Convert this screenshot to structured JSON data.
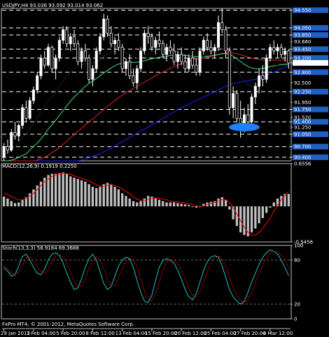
{
  "header": {
    "symbol_line": "USDJPY,H4  93.036 93.092 93.014 93.062",
    "macd_label": "MACD(12,26,9) 0.1919 0.2250",
    "stoch_label": "Stoch(13,3,3) 58.9184 69.3688",
    "footer_label": "FxPro MT4, © 2001-2012, MetaQuotes Software Corp."
  },
  "colors": {
    "background": "#000000",
    "frame": "#c0c0c0",
    "up_candle": "#ffffff",
    "down_candle": "#000000",
    "candle_outline": "#ffffff",
    "level_line": "#ffffff",
    "level_box": "#2060c0",
    "price_box": "#ffffff",
    "ma_fast": "#000000",
    "ma_green": "#40e080",
    "ma_red": "#e02020",
    "ma_blue": "#2020ff",
    "macd_hist": "#c0c0c0",
    "macd_signal": "#ff0000",
    "stoch_main": "#20c0c0",
    "stoch_signal": "#ff0000",
    "ellipse": "#1e80ff"
  },
  "chart_data": [
    {
      "type": "candlestick",
      "title": "USDJPY,H4",
      "ylim": [
        90.3,
        94.6
      ],
      "price_labels": [
        {
          "value": 94.55,
          "label": "94.550"
        },
        {
          "value": 94.05,
          "label": "94.050"
        },
        {
          "value": 93.85,
          "label": "93.850"
        },
        {
          "value": 93.66,
          "label": "93.660"
        },
        {
          "value": 93.45,
          "label": "93.450"
        },
        {
          "value": 93.2,
          "label": "93.200"
        },
        {
          "value": 93.062,
          "label": "93.062",
          "current": true
        },
        {
          "value": 92.8,
          "label": "92.800"
        },
        {
          "value": 92.5,
          "label": "92.500"
        },
        {
          "value": 92.25,
          "label": "92.250"
        },
        {
          "value": 91.95,
          "label": "91.950"
        },
        {
          "value": 91.75,
          "label": "91.750"
        },
        {
          "value": 91.52,
          "label": "91.520"
        },
        {
          "value": 91.4,
          "label": "91.400"
        },
        {
          "value": 91.25,
          "label": "91.250"
        },
        {
          "value": 91.05,
          "label": "91.050"
        },
        {
          "value": 90.7,
          "label": "90.700"
        },
        {
          "value": 90.4,
          "label": "90.400"
        }
      ],
      "levels": [
        94.55,
        94.05,
        93.85,
        93.45,
        93.2,
        92.8,
        92.25,
        91.75,
        91.4,
        91.05,
        90.7,
        90.4
      ],
      "ohlc": [
        [
          90.4,
          90.8,
          90.3,
          90.7
        ],
        [
          90.7,
          90.9,
          90.5,
          90.6
        ],
        [
          90.6,
          91.2,
          90.55,
          91.1
        ],
        [
          91.1,
          91.4,
          90.9,
          91.0
        ],
        [
          91.0,
          91.35,
          90.85,
          91.3
        ],
        [
          91.3,
          91.9,
          91.2,
          91.8
        ],
        [
          91.8,
          92.0,
          91.4,
          91.5
        ],
        [
          91.5,
          92.1,
          91.45,
          92.0
        ],
        [
          92.0,
          92.4,
          91.9,
          92.3
        ],
        [
          92.3,
          92.8,
          92.2,
          92.7
        ],
        [
          92.7,
          93.3,
          92.6,
          93.2
        ],
        [
          93.2,
          93.4,
          92.9,
          93.0
        ],
        [
          93.0,
          93.6,
          92.95,
          93.5
        ],
        [
          93.5,
          93.55,
          92.8,
          92.9
        ],
        [
          92.9,
          93.3,
          92.6,
          93.2
        ],
        [
          93.2,
          93.8,
          93.1,
          93.7
        ],
        [
          93.7,
          94.1,
          93.6,
          94.0
        ],
        [
          94.0,
          94.1,
          93.5,
          93.6
        ],
        [
          93.6,
          93.9,
          93.4,
          93.8
        ],
        [
          93.8,
          94.0,
          93.5,
          93.6
        ],
        [
          93.6,
          93.7,
          93.0,
          93.1
        ],
        [
          93.1,
          93.5,
          92.9,
          93.4
        ],
        [
          93.4,
          93.6,
          93.1,
          93.2
        ],
        [
          93.2,
          93.3,
          92.5,
          92.6
        ],
        [
          92.6,
          93.0,
          92.4,
          92.9
        ],
        [
          92.9,
          93.5,
          92.8,
          93.4
        ],
        [
          93.4,
          93.9,
          93.3,
          93.8
        ],
        [
          93.8,
          94.45,
          93.7,
          94.3
        ],
        [
          94.3,
          94.4,
          93.8,
          93.9
        ],
        [
          93.9,
          94.1,
          93.5,
          93.6
        ],
        [
          93.6,
          93.8,
          93.3,
          93.7
        ],
        [
          93.7,
          93.9,
          93.4,
          93.5
        ],
        [
          93.5,
          93.6,
          92.8,
          92.9
        ],
        [
          92.9,
          93.2,
          92.7,
          93.1
        ],
        [
          93.1,
          93.3,
          92.6,
          92.7
        ],
        [
          92.7,
          92.9,
          92.4,
          92.5
        ],
        [
          92.5,
          93.0,
          92.3,
          92.9
        ],
        [
          92.9,
          93.5,
          92.8,
          93.4
        ],
        [
          93.4,
          94.0,
          93.3,
          93.9
        ],
        [
          93.9,
          94.1,
          93.6,
          93.8
        ],
        [
          93.8,
          93.9,
          93.4,
          93.5
        ],
        [
          93.5,
          93.8,
          93.3,
          93.7
        ],
        [
          93.7,
          93.95,
          93.5,
          93.6
        ],
        [
          93.6,
          93.7,
          93.2,
          93.3
        ],
        [
          93.3,
          93.6,
          93.1,
          93.5
        ],
        [
          93.5,
          93.7,
          93.3,
          93.4
        ],
        [
          93.4,
          93.6,
          93.0,
          93.1
        ],
        [
          93.1,
          93.4,
          92.9,
          93.3
        ],
        [
          93.3,
          93.5,
          93.0,
          93.1
        ],
        [
          93.1,
          93.3,
          92.8,
          92.9
        ],
        [
          92.9,
          93.3,
          92.8,
          93.2
        ],
        [
          93.2,
          93.4,
          92.9,
          93.0
        ],
        [
          93.0,
          93.2,
          92.7,
          92.8
        ],
        [
          92.8,
          93.5,
          92.7,
          93.4
        ],
        [
          93.4,
          93.8,
          93.3,
          93.7
        ],
        [
          93.7,
          93.9,
          93.4,
          93.5
        ],
        [
          93.5,
          93.7,
          93.3,
          93.4
        ],
        [
          93.4,
          93.6,
          93.2,
          93.5
        ],
        [
          93.5,
          94.4,
          93.4,
          94.2
        ],
        [
          94.2,
          94.6,
          93.9,
          94.0
        ],
        [
          94.0,
          94.1,
          93.2,
          93.4
        ],
        [
          93.4,
          93.5,
          91.6,
          91.8
        ],
        [
          91.8,
          92.4,
          91.5,
          92.2
        ],
        [
          92.2,
          92.3,
          91.4,
          91.5
        ],
        [
          91.5,
          92.0,
          90.95,
          91.2
        ],
        [
          91.2,
          91.8,
          91.1,
          91.6
        ],
        [
          91.6,
          91.9,
          91.3,
          91.4
        ],
        [
          91.4,
          92.2,
          91.3,
          92.1
        ],
        [
          92.1,
          92.5,
          91.9,
          92.4
        ],
        [
          92.4,
          92.9,
          92.2,
          92.7
        ],
        [
          92.7,
          93.0,
          92.4,
          92.6
        ],
        [
          92.6,
          93.3,
          92.5,
          93.2
        ],
        [
          93.2,
          93.6,
          93.1,
          93.5
        ],
        [
          93.5,
          93.7,
          93.3,
          93.4
        ],
        [
          93.4,
          93.6,
          93.2,
          93.5
        ],
        [
          93.5,
          93.6,
          93.2,
          93.3
        ],
        [
          93.3,
          93.5,
          93.1,
          93.4
        ],
        [
          93.4,
          93.45,
          92.9,
          93.06
        ]
      ],
      "ma_black": [
        90.5,
        90.52,
        90.6,
        90.7,
        90.8,
        90.95,
        91.05,
        91.2,
        91.35,
        91.5,
        91.7,
        91.85,
        92.0,
        92.1,
        92.25,
        92.4,
        92.55,
        92.7,
        92.8,
        92.9,
        92.95,
        93.0,
        93.05,
        93.05,
        93.05,
        93.1,
        93.15,
        93.25,
        93.3,
        93.35,
        93.4,
        93.42,
        93.4,
        93.35,
        93.3,
        93.25,
        93.2,
        93.2,
        93.25,
        93.3,
        93.35,
        93.4,
        93.42,
        93.4,
        93.4,
        93.42,
        93.4,
        93.38,
        93.35,
        93.3,
        93.28,
        93.25,
        93.2,
        93.2,
        93.25,
        93.3,
        93.32,
        93.35,
        93.4,
        93.45,
        93.45,
        93.3,
        93.1,
        92.9,
        92.7,
        92.55,
        92.45,
        92.4,
        92.42,
        92.5,
        92.6,
        92.7,
        92.85,
        92.95,
        93.0,
        93.05,
        93.05,
        93.05
      ],
      "ma_green": [
        90.3,
        90.3,
        90.32,
        90.35,
        90.4,
        90.45,
        90.5,
        90.6,
        90.7,
        90.8,
        90.92,
        91.05,
        91.2,
        91.32,
        91.45,
        91.58,
        91.72,
        91.85,
        91.98,
        92.1,
        92.2,
        92.3,
        92.4,
        92.48,
        92.55,
        92.62,
        92.7,
        92.78,
        92.85,
        92.92,
        92.98,
        93.03,
        93.05,
        93.07,
        93.08,
        93.08,
        93.08,
        93.1,
        93.12,
        93.15,
        93.18,
        93.2,
        93.22,
        93.24,
        93.25,
        93.27,
        93.28,
        93.28,
        93.28,
        93.27,
        93.26,
        93.25,
        93.24,
        93.23,
        93.24,
        93.25,
        93.26,
        93.28,
        93.3,
        93.32,
        93.33,
        93.3,
        93.25,
        93.18,
        93.1,
        93.02,
        92.96,
        92.92,
        92.9,
        92.9,
        92.91,
        92.93,
        92.96,
        92.98,
        93.0,
        93.01,
        93.02,
        93.02
      ],
      "ma_red": [
        90.3,
        90.3,
        90.3,
        90.3,
        90.3,
        90.3,
        90.3,
        90.3,
        90.3,
        90.32,
        90.35,
        90.4,
        90.46,
        90.53,
        90.6,
        90.68,
        90.77,
        90.86,
        90.95,
        91.04,
        91.13,
        91.22,
        91.31,
        91.4,
        91.48,
        91.57,
        91.66,
        91.75,
        91.84,
        91.92,
        92.0,
        92.08,
        92.15,
        92.22,
        92.28,
        92.34,
        92.4,
        92.46,
        92.52,
        92.58,
        92.64,
        92.7,
        92.76,
        92.81,
        92.86,
        92.91,
        92.96,
        93.0,
        93.04,
        93.07,
        93.1,
        93.13,
        93.16,
        93.18,
        93.2,
        93.22,
        93.24,
        93.27,
        93.3,
        93.33,
        93.35,
        93.35,
        93.34,
        93.32,
        93.29,
        93.26,
        93.23,
        93.2,
        93.18,
        93.16,
        93.15,
        93.14,
        93.14,
        93.14,
        93.14,
        93.14,
        93.14,
        93.13
      ],
      "ma_blue": [
        90.3,
        90.3,
        90.3,
        90.3,
        90.3,
        90.3,
        90.3,
        90.3,
        90.3,
        90.3,
        90.3,
        90.3,
        90.3,
        90.3,
        90.3,
        90.3,
        90.3,
        90.3,
        90.3,
        90.3,
        90.3,
        90.32,
        90.35,
        90.38,
        90.42,
        90.46,
        90.5,
        90.55,
        90.6,
        90.66,
        90.72,
        90.78,
        90.84,
        90.9,
        90.96,
        91.02,
        91.08,
        91.14,
        91.2,
        91.26,
        91.32,
        91.38,
        91.44,
        91.5,
        91.56,
        91.62,
        91.68,
        91.74,
        91.8,
        91.85,
        91.9,
        91.95,
        92.0,
        92.05,
        92.1,
        92.15,
        92.2,
        92.25,
        92.3,
        92.35,
        92.4,
        92.45,
        92.48,
        92.5,
        92.52,
        92.54,
        92.56,
        92.58,
        92.6,
        92.62,
        92.66,
        92.7,
        92.75,
        92.8,
        92.85,
        92.9,
        92.94,
        92.98
      ]
    },
    {
      "type": "macd",
      "title": "MACD(12,26,9) 0.1919 0.2250",
      "ylim": [
        -0.5456,
        0.6556
      ],
      "price_labels": [
        {
          "value": 0.6556,
          "label": "0.6556"
        },
        {
          "value": -0.5456,
          "label": "-0.5456"
        }
      ],
      "histogram": [
        0.15,
        0.12,
        0.08,
        0.05,
        0.06,
        0.1,
        0.14,
        0.2,
        0.26,
        0.32,
        0.38,
        0.44,
        0.48,
        0.5,
        0.5,
        0.51,
        0.52,
        0.5,
        0.46,
        0.44,
        0.42,
        0.4,
        0.38,
        0.34,
        0.3,
        0.28,
        0.3,
        0.34,
        0.36,
        0.34,
        0.3,
        0.26,
        0.2,
        0.16,
        0.12,
        0.08,
        0.06,
        0.08,
        0.12,
        0.16,
        0.15,
        0.12,
        0.1,
        0.08,
        0.06,
        0.06,
        0.06,
        0.05,
        0.04,
        0.03,
        0.02,
        0.0,
        -0.02,
        0.0,
        0.04,
        0.06,
        0.07,
        0.08,
        0.12,
        0.14,
        0.1,
        -0.05,
        -0.2,
        -0.3,
        -0.4,
        -0.44,
        -0.46,
        -0.4,
        -0.34,
        -0.26,
        -0.18,
        -0.1,
        -0.02,
        0.06,
        0.12,
        0.16,
        0.19,
        0.19
      ],
      "signal": [
        0.2,
        0.18,
        0.15,
        0.12,
        0.1,
        0.1,
        0.12,
        0.16,
        0.2,
        0.26,
        0.32,
        0.38,
        0.42,
        0.46,
        0.48,
        0.49,
        0.5,
        0.5,
        0.49,
        0.47,
        0.45,
        0.43,
        0.41,
        0.39,
        0.36,
        0.33,
        0.31,
        0.31,
        0.32,
        0.33,
        0.32,
        0.3,
        0.27,
        0.23,
        0.19,
        0.15,
        0.11,
        0.09,
        0.09,
        0.11,
        0.12,
        0.13,
        0.12,
        0.11,
        0.1,
        0.08,
        0.07,
        0.07,
        0.06,
        0.05,
        0.04,
        0.03,
        0.01,
        0.0,
        0.01,
        0.03,
        0.05,
        0.06,
        0.08,
        0.1,
        0.1,
        0.06,
        -0.02,
        -0.12,
        -0.22,
        -0.32,
        -0.4,
        -0.44,
        -0.44,
        -0.4,
        -0.34,
        -0.26,
        -0.18,
        -0.08,
        0.02,
        0.1,
        0.16,
        0.225
      ]
    },
    {
      "type": "stochastic",
      "title": "Stoch(13,3,3) 58.9184 69.3688",
      "ylim": [
        0,
        100
      ],
      "price_labels": [
        {
          "value": 100,
          "label": "100"
        },
        {
          "value": 80,
          "label": "80"
        },
        {
          "value": 20,
          "label": "20"
        },
        {
          "value": 0,
          "label": "0"
        }
      ],
      "main": [
        70,
        65,
        58,
        60,
        72,
        85,
        88,
        80,
        70,
        62,
        60,
        68,
        80,
        88,
        90,
        86,
        76,
        62,
        50,
        40,
        42,
        55,
        70,
        82,
        88,
        80,
        64,
        48,
        40,
        44,
        58,
        72,
        80,
        84,
        82,
        70,
        52,
        36,
        24,
        22,
        32,
        52,
        70,
        80,
        82,
        80,
        76,
        66,
        54,
        40,
        30,
        26,
        34,
        50,
        66,
        78,
        84,
        86,
        84,
        72,
        56,
        40,
        30,
        24,
        20,
        24,
        36,
        50,
        62,
        74,
        84,
        90,
        94,
        92,
        88,
        80,
        70,
        59
      ],
      "signal": [
        72,
        68,
        63,
        60,
        64,
        72,
        82,
        85,
        79,
        71,
        64,
        62,
        68,
        78,
        86,
        88,
        84,
        75,
        63,
        51,
        44,
        45,
        55,
        68,
        79,
        84,
        80,
        68,
        54,
        44,
        46,
        56,
        68,
        78,
        82,
        80,
        70,
        54,
        38,
        27,
        25,
        34,
        50,
        66,
        77,
        80,
        80,
        75,
        66,
        54,
        42,
        32,
        29,
        37,
        50,
        64,
        76,
        83,
        85,
        81,
        71,
        56,
        42,
        32,
        25,
        22,
        26,
        36,
        49,
        62,
        73,
        83,
        89,
        92,
        91,
        87,
        80,
        69
      ]
    }
  ],
  "x_axis": {
    "tick_labels": [
      "29 Jan 2013",
      "1 Feb 04:00",
      "5 Feb 20:00",
      "8 Feb 12:00",
      "13 Feb 04:00",
      "15 Feb 20:00",
      "20 Feb 12:00",
      "25 Feb 04:00",
      "27 Feb 20:00",
      "4 Mar 12:00"
    ],
    "tick_bars": [
      0,
      8,
      16,
      24,
      32,
      40,
      48,
      56,
      64,
      72
    ]
  },
  "annotations": [
    {
      "type": "ellipse",
      "name": "support-zone-ellipse",
      "x_bar": 65,
      "y": 91.25,
      "color": "#1e80ff"
    }
  ]
}
